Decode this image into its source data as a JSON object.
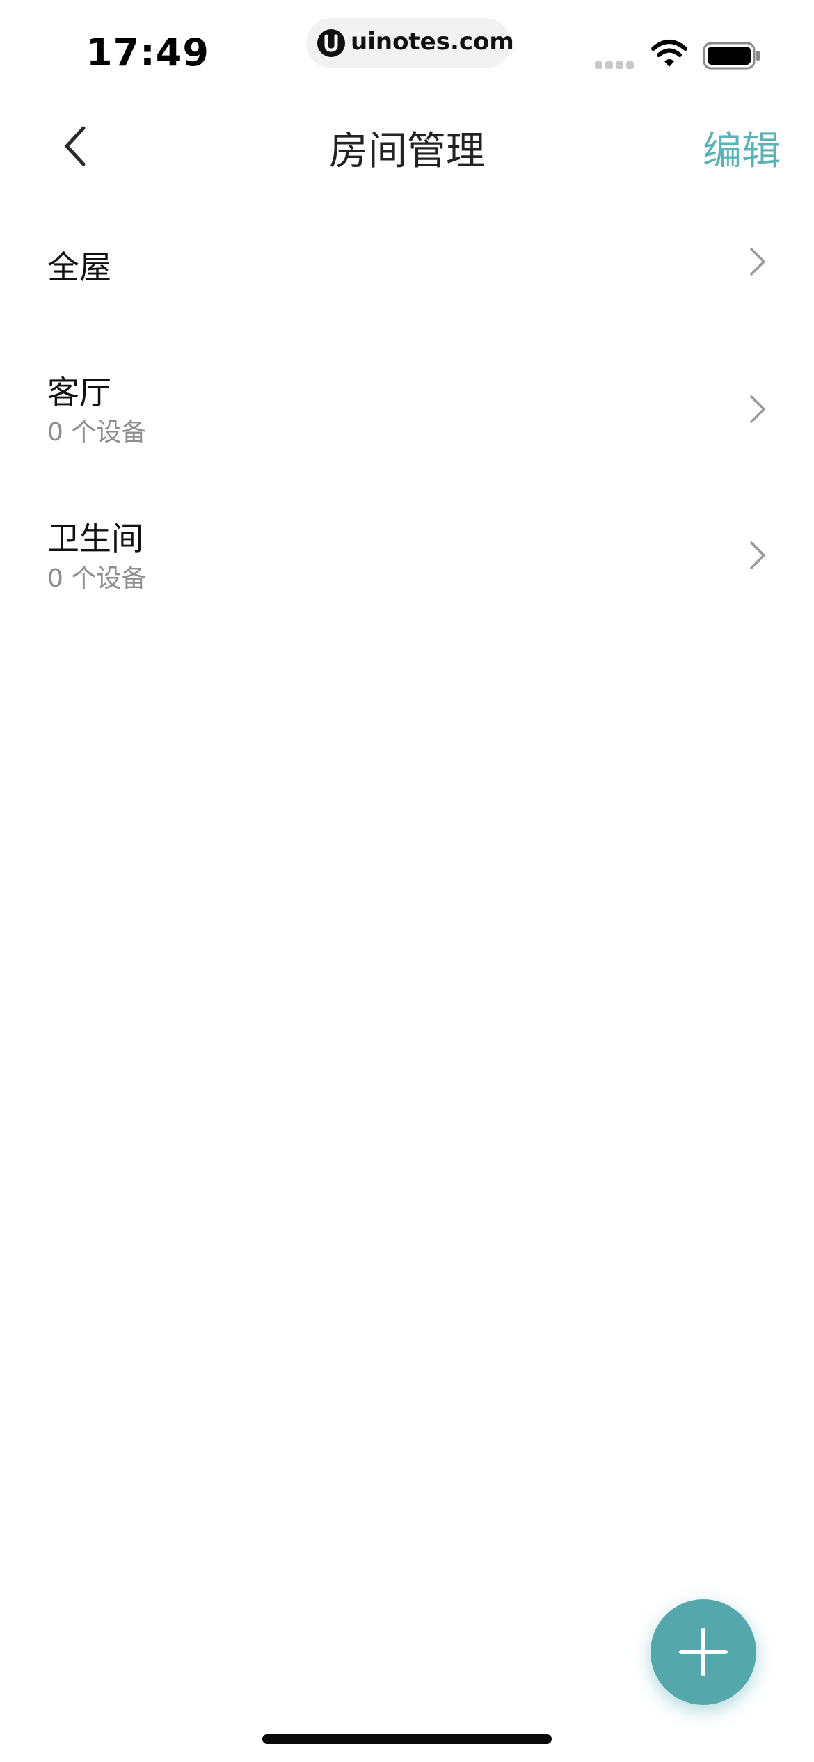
{
  "status_bar": {
    "time": "17:49",
    "url": "uinotes.com",
    "icons": [
      "signal-icon",
      "wifi-icon",
      "battery-icon"
    ]
  },
  "nav": {
    "back_icon": "chevron-left-icon",
    "title": "房间管理",
    "edit_label": "编辑"
  },
  "rooms": [
    {
      "name": "全屋",
      "device_count": ""
    },
    {
      "name": "客厅",
      "device_count": "0 个设备"
    },
    {
      "name": "卫生间",
      "device_count": "0 个设备"
    }
  ],
  "fab": {
    "icon": "plus-icon"
  },
  "colors": {
    "accent": "#5bb3b5",
    "fab": "#54a8ab",
    "secondary_text": "#8e8e8e"
  }
}
